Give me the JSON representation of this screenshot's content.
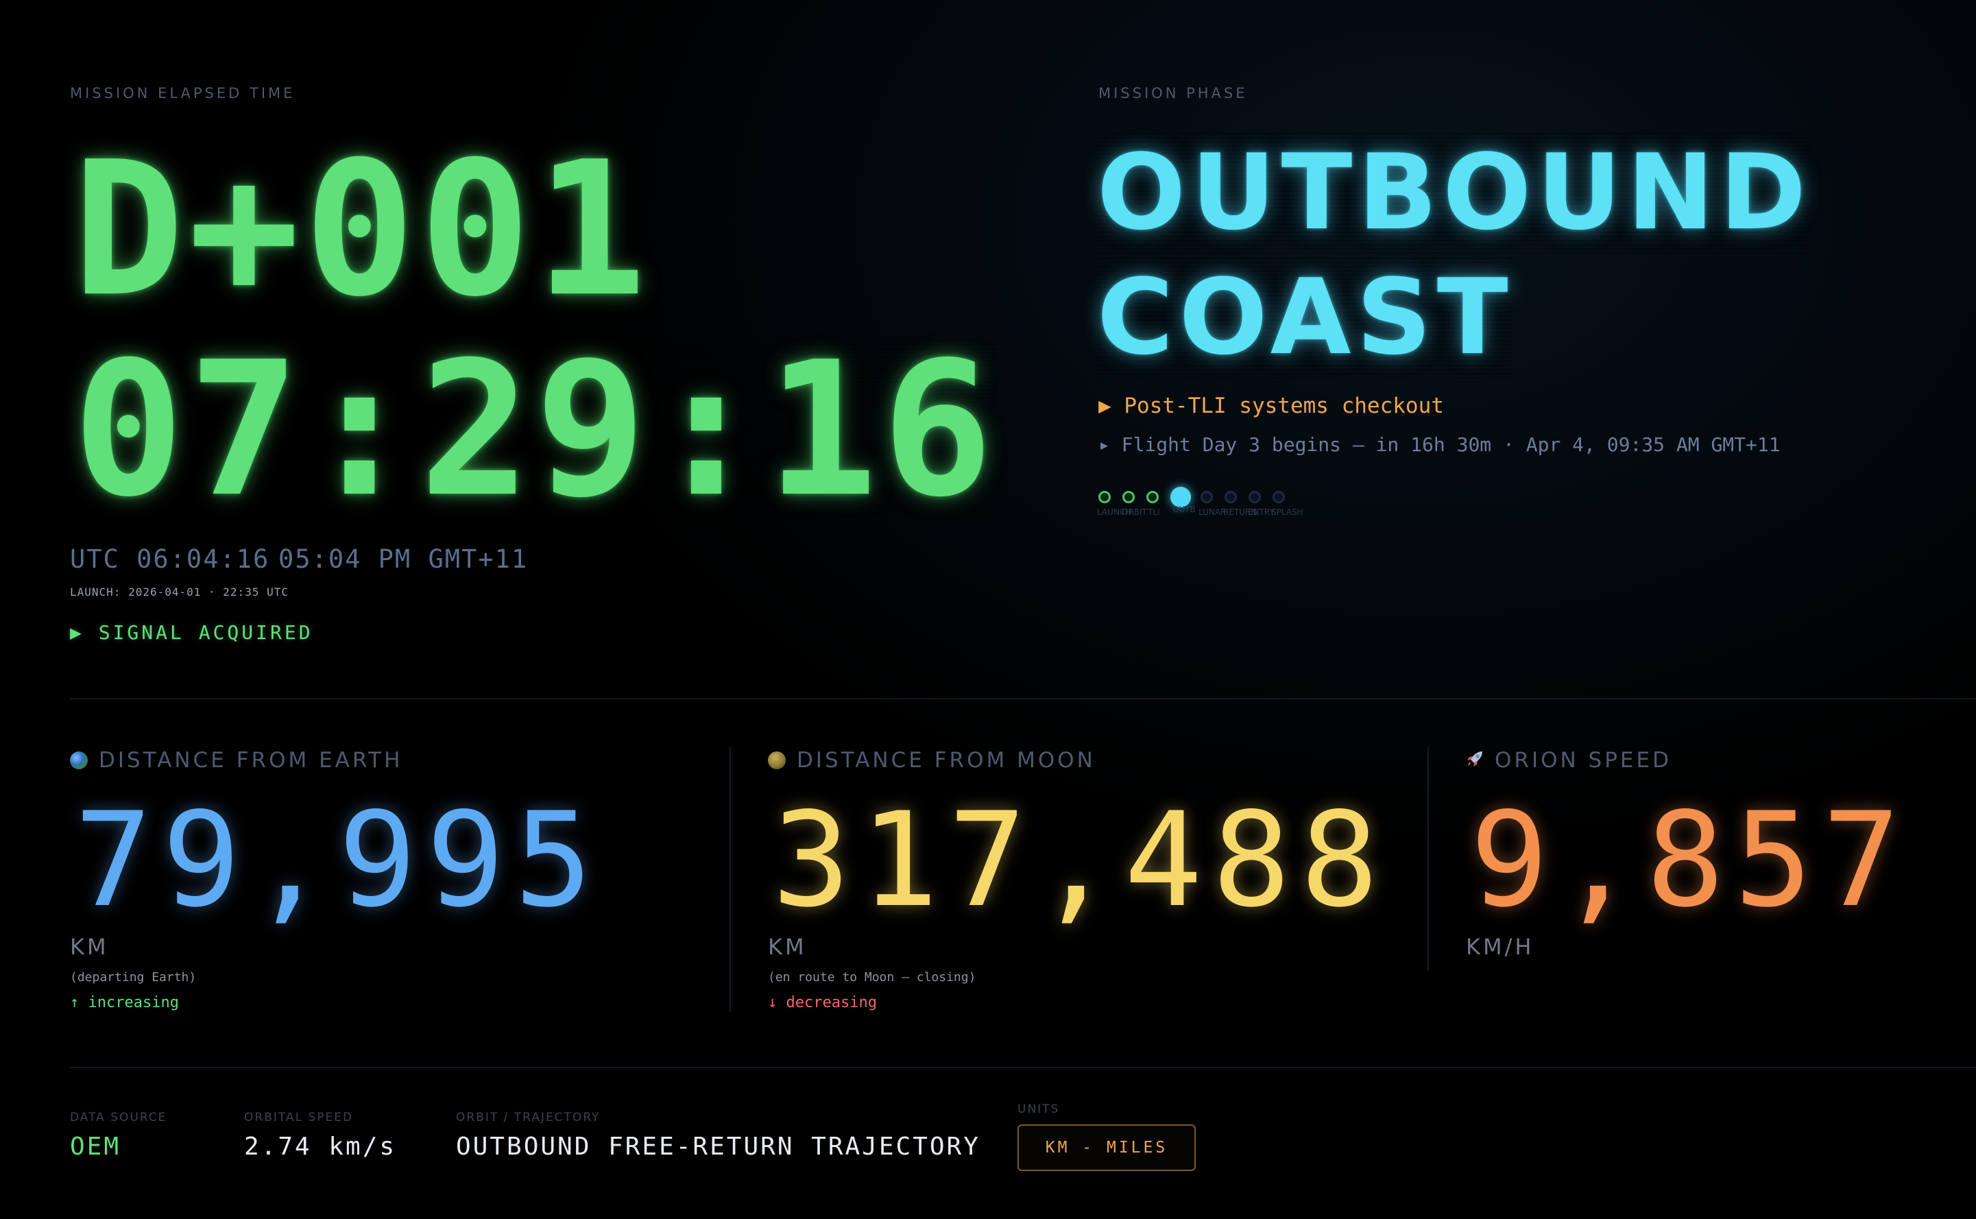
{
  "met": {
    "label": "MISSION ELAPSED TIME",
    "day": "D+001",
    "clock": "07:29:16",
    "utc": "UTC 06:04:16",
    "local": "05:04 PM GMT+11",
    "launch": "LAUNCH: 2026-04-01 · 22:35 UTC",
    "signal": "▶ SIGNAL ACQUIRED"
  },
  "phase": {
    "label": "MISSION PHASE",
    "line1": "OUTBOUND",
    "line2": "COAST",
    "activity": "▶ Post-TLI systems checkout",
    "next": "▸ Flight Day 3 begins — in 16h 30m · Apr 4, 09:35 AM GMT+11",
    "timeline": [
      {
        "label": "LAUNCH",
        "state": "done"
      },
      {
        "label": "ORBIT",
        "state": "done"
      },
      {
        "label": "TLI",
        "state": "done"
      },
      {
        "label": "OUTB",
        "state": "active"
      },
      {
        "label": "LUNAR",
        "state": "todo"
      },
      {
        "label": "RETURN",
        "state": "todo"
      },
      {
        "label": "ENTRY",
        "state": "todo"
      },
      {
        "label": "SPLASH",
        "state": "todo"
      }
    ]
  },
  "stats": {
    "earth": {
      "icon": "earth-icon",
      "label": "DISTANCE FROM EARTH",
      "value": "79,995",
      "unit": "KM",
      "note": "(departing Earth)",
      "trend": "↑ increasing",
      "color": "#5eaaf2"
    },
    "moon": {
      "icon": "moon-icon",
      "label": "DISTANCE FROM MOON",
      "value": "317,488",
      "unit": "KM",
      "note": "(en route to Moon — closing)",
      "trend": "↓ decreasing",
      "color": "#f6d86a"
    },
    "speed": {
      "icon": "rocket-icon",
      "label": "ORION SPEED",
      "value": "9,857",
      "unit": "KM/H",
      "color": "#f3904e"
    }
  },
  "footer": {
    "source_label": "DATA SOURCE",
    "source_value": "OEM",
    "orbital_label": "ORBITAL SPEED",
    "orbital_value": "2.74 km/s",
    "trajectory_label": "ORBIT / TRAJECTORY",
    "trajectory_value": "OUTBOUND FREE-RETURN TRAJECTORY",
    "units_label": "UNITS",
    "units_toggle": "KM - MILES"
  }
}
